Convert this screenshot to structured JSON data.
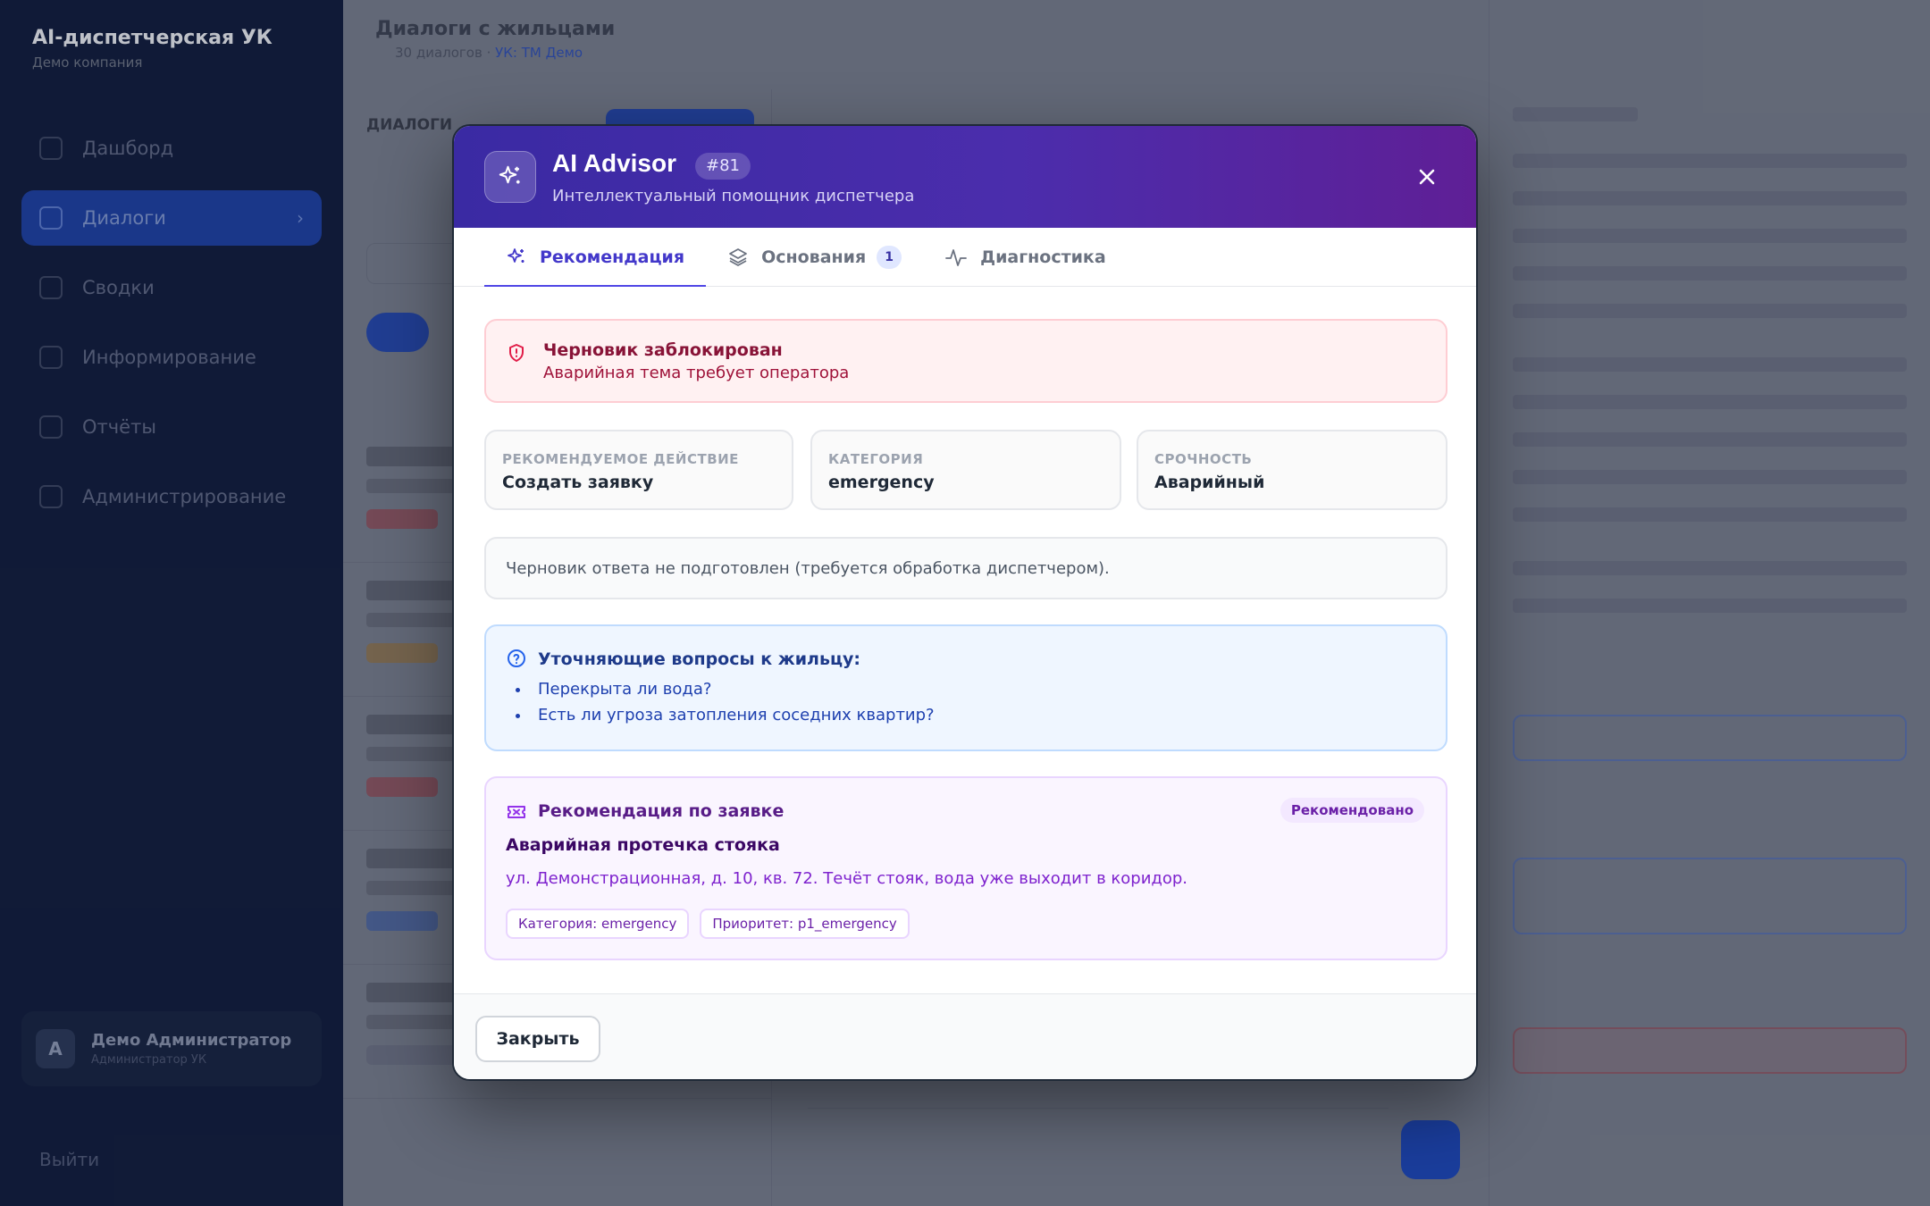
{
  "background": {
    "app_name": "AI-диспетчерская УК",
    "app_sub": "Демо компания",
    "nav": [
      "Дашборд",
      "Диалоги",
      "Сводки",
      "Информирование",
      "Отчёты",
      "Администрирование"
    ],
    "user_initial": "А",
    "user_name": "Демо Администратор",
    "user_sub": "Администратор УК",
    "logout": "Выйти",
    "page_title": "Диалоги с жильцами",
    "page_sub_prefix": "30 диалогов · ",
    "page_sub_link": "УК: ТМ Демо",
    "list_header": "ДИАЛОГИ"
  },
  "modal": {
    "title": "AI Advisor",
    "badge": "#81",
    "subtitle": "Интеллектуальный помощник диспетчера",
    "tabs": [
      {
        "label": "Рекомендация",
        "active": true
      },
      {
        "label": "Основания",
        "count": "1"
      },
      {
        "label": "Диагностика"
      }
    ],
    "alert": {
      "title": "Черновик заблокирован",
      "text": "Аварийная тема требует оператора"
    },
    "cards": [
      {
        "label": "РЕКОМЕНДУЕМОЕ ДЕЙСТВИЕ",
        "value": "Создать заявку"
      },
      {
        "label": "КАТЕГОРИЯ",
        "value": "emergency"
      },
      {
        "label": "СРОЧНОСТЬ",
        "value": "Аварийный"
      }
    ],
    "draft_text": "Черновик ответа не подготовлен (требуется обработка диспетчером).",
    "questions": {
      "title": "Уточняющие вопросы к жильцу:",
      "items": [
        "Перекрыта ли вода?",
        "Есть ли угроза затопления соседних квартир?"
      ]
    },
    "recommendation": {
      "title": "Рекомендация по заявке",
      "badge": "Рекомендовано",
      "heading": "Аварийная протечка стояка",
      "description": "ул. Демонстрационная, д. 10, кв. 72. Течёт стояк, вода уже выходит в коридор.",
      "chips": [
        "Категория: emergency",
        "Приоритет: p1_emergency"
      ]
    },
    "close_label": "Закрыть"
  },
  "colors": {
    "header_gradient_start": "#3a2aa3",
    "header_gradient_end": "#5f1f96",
    "accent": "#4f46e5",
    "alert_bg": "#fff1f2",
    "questions_bg": "#eff6ff",
    "recommendation_bg": "#faf5ff"
  }
}
